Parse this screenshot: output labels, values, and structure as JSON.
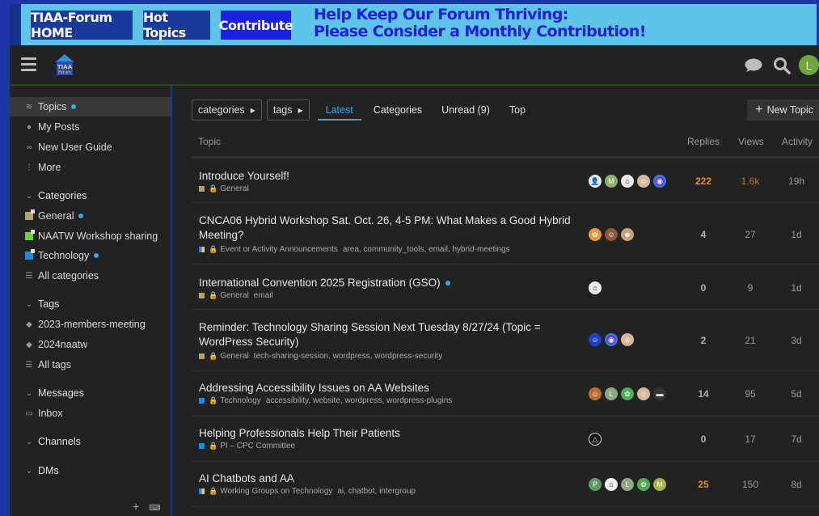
{
  "banner": {
    "home": "TIAA-Forum HOME",
    "hot": "Hot Topics",
    "contribute": "Contribute",
    "message_line1": "Help Keep Our Forum Thriving:",
    "message_line2": "Please Consider a Monthly Contribution!"
  },
  "header": {
    "logo_text_top": "TIAA",
    "logo_text_bottom": "Forum",
    "avatar_letter": "L"
  },
  "sidebar": {
    "topics": "Topics",
    "my_posts": "My Posts",
    "new_user_guide": "New User Guide",
    "more": "More",
    "categories_head": "Categories",
    "cat_general": "General",
    "cat_naatw": "NAATW Workshop sharing",
    "cat_technology": "Technology",
    "all_categories": "All categories",
    "tags_head": "Tags",
    "tag_1": "2023-members-meeting",
    "tag_2": "2024naatw",
    "all_tags": "All tags",
    "messages_head": "Messages",
    "inbox": "Inbox",
    "channels_head": "Channels",
    "dms_head": "DMs",
    "colors": {
      "general": "#b3a36b",
      "naatw": "#6bd42d",
      "technology": "#1e88e5"
    }
  },
  "nav": {
    "categories_dd": "categories",
    "tags_dd": "tags",
    "latest": "Latest",
    "categories": "Categories",
    "unread": "Unread (9)",
    "top": "Top",
    "new_topic": "New Topic"
  },
  "columns": {
    "topic": "Topic",
    "replies": "Replies",
    "views": "Views",
    "activity": "Activity"
  },
  "topics": [
    {
      "title": "Introduce Yourself!",
      "category": "General",
      "tags": "",
      "replies": "222",
      "views": "1.6k",
      "activity": "19h"
    },
    {
      "title": "CNCA06 Hybrid Workshop Sat. Oct. 26, 4-5 PM: What Makes a Good Hybrid Meeting?",
      "category": "Event or Activity Announcements",
      "tags": "area, community_tools, email, hybrid-meetings",
      "replies": "4",
      "views": "27",
      "activity": "1d"
    },
    {
      "title": "International Convention 2025 Registration (GSO)",
      "category": "General",
      "tags": "email",
      "replies": "0",
      "views": "9",
      "activity": "1d"
    },
    {
      "title": "Reminder: Technology Sharing Session Next Tuesday 8/27/24 (Topic = WordPress Security)",
      "category": "General",
      "tags": "tech-sharing-session, wordpress, wordpress-security",
      "replies": "2",
      "views": "21",
      "activity": "3d"
    },
    {
      "title": "Addressing Accessibility Issues on AA Websites",
      "category": "Technology",
      "tags": "accessibility, website, wordpress, wordpress-plugins",
      "replies": "14",
      "views": "95",
      "activity": "5d"
    },
    {
      "title": "Helping Professionals Help Their Patients",
      "category": "PI – CPC Committee",
      "tags": "",
      "replies": "0",
      "views": "17",
      "activity": "7d"
    },
    {
      "title": "AI Chatbots and AA",
      "category": "Working Groups on Technology",
      "tags": "ai, chatbot, intergroup",
      "replies": "25",
      "views": "150",
      "activity": "8d"
    }
  ],
  "avatar_letters": {
    "m": "M",
    "l": "L",
    "p": "P"
  }
}
